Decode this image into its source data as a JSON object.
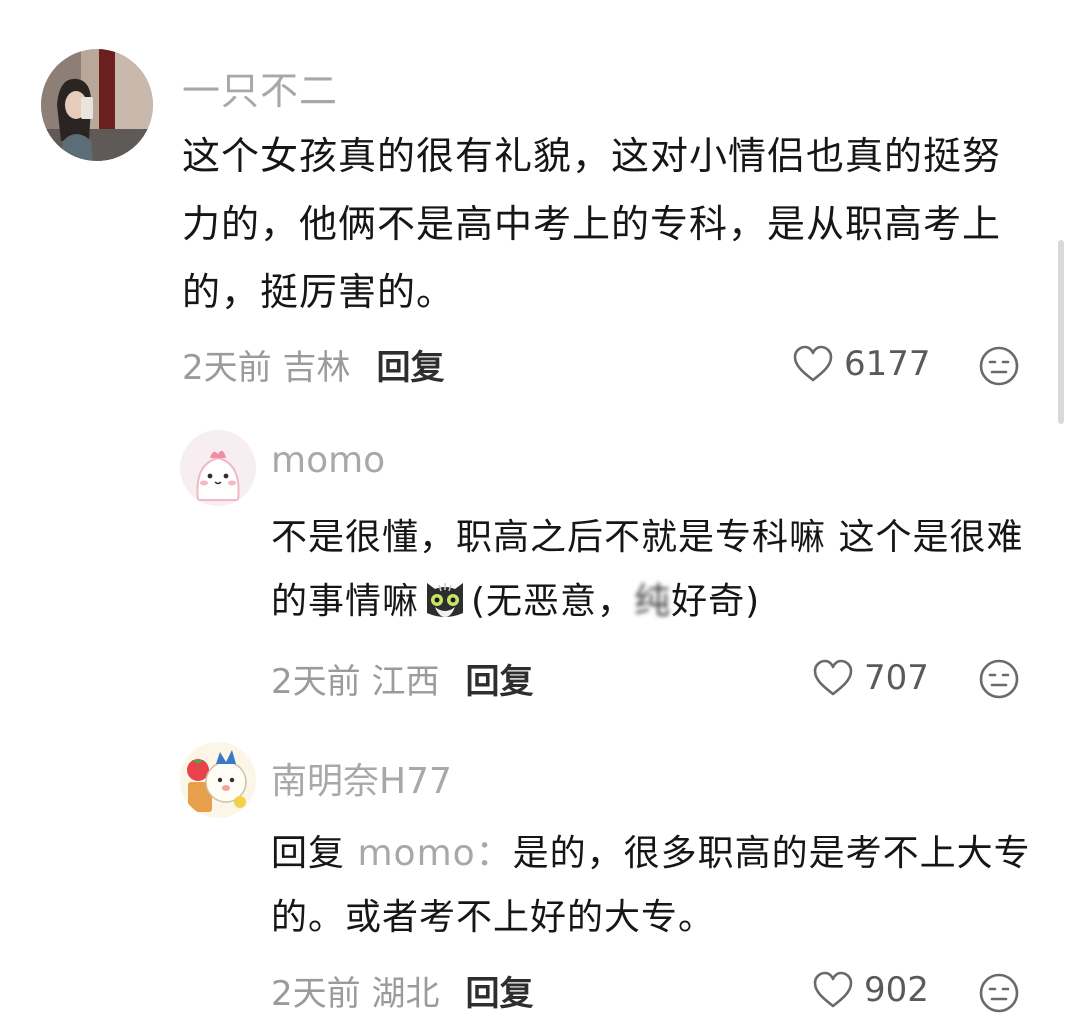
{
  "comments": [
    {
      "username": "一只不二",
      "text": "这个女孩真的很有礼貌，这对小情侣也真的挺努力的，他俩不是高中考上的专科，是从职高考上的，挺厉害的。",
      "time_location": "2天前 吉林",
      "reply_label": "回复",
      "likes": "6177",
      "avatar_icon": "photo-avatar-girl"
    },
    {
      "username": "momo",
      "text_before_emoji": "不是很懂，职高之后不就是专科嘛 这个是很难的事情嘛",
      "emoji_icon": "cat-emoji",
      "text_after_emoji_start": "(无恶意，",
      "text_after_emoji_blurred": "纯",
      "text_after_emoji_end": "好奇)",
      "time_location": "2天前 江西",
      "reply_label": "回复",
      "likes": "707",
      "avatar_icon": "pink-cartoon-avatar"
    },
    {
      "username": "南明奈H77",
      "reply_prefix": "回复",
      "mention": "momo：",
      "text": "是的，很多职高的是考不上大专的。或者考不上好的大专。",
      "time_location": "2天前 湖北",
      "reply_label": "回复",
      "likes": "902",
      "avatar_icon": "cartoon-avatar-strawberry"
    }
  ],
  "colors": {
    "username": "#a8a8a8",
    "body": "#161616",
    "meta": "#9b9b9b",
    "icon": "#6a6a6a"
  }
}
